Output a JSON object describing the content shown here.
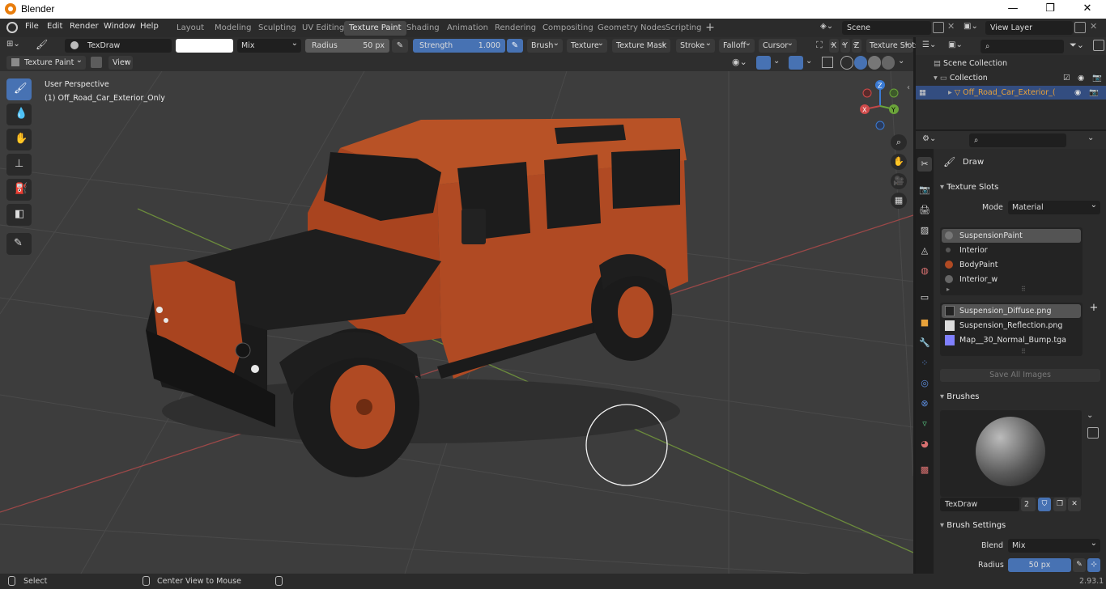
{
  "window": {
    "title": "Blender",
    "minimize": "—",
    "maximize": "❐",
    "close": "✕"
  },
  "menu": [
    "File",
    "Edit",
    "Render",
    "Window",
    "Help"
  ],
  "workspaces": [
    "Layout",
    "Modeling",
    "Sculpting",
    "UV Editing",
    "Texture Paint",
    "Shading",
    "Animation",
    "Rendering",
    "Compositing",
    "Geometry Nodes",
    "Scripting"
  ],
  "active_workspace": "Texture Paint",
  "scene": {
    "name": "Scene",
    "view_layer": "View Layer"
  },
  "tool_header": {
    "brush_name": "TexDraw",
    "blend": "Mix",
    "radius_label": "Radius",
    "radius_value": "50 px",
    "strength_label": "Strength",
    "strength_value": "1.000",
    "menus": [
      "Brush",
      "Texture",
      "Texture Mask",
      "Stroke",
      "Falloff",
      "Cursor"
    ],
    "axes": [
      "X",
      "Y",
      "Z"
    ],
    "texture_slots": "Texture Slots"
  },
  "header2": {
    "mode": "Texture Paint",
    "view": "View"
  },
  "viewport": {
    "perspective": "User Perspective",
    "object": "(1) Off_Road_Car_Exterior_Only",
    "gizmo": {
      "x": "X",
      "y": "Y",
      "z": "Z"
    }
  },
  "outliner": {
    "scene_collection": "Scene Collection",
    "collection": "Collection",
    "object": "Off_Road_Car_Exterior_("
  },
  "properties": {
    "tool_name": "Draw",
    "texture_slots_title": "Texture Slots",
    "mode_label": "Mode",
    "mode_value": "Material",
    "materials": [
      "SuspensionPaint",
      "Interior",
      "BodyPaint",
      "Interior_w"
    ],
    "images": [
      "Suspension_Diffuse.png",
      "Suspension_Reflection.png",
      "Map__30_Normal_Bump.tga"
    ],
    "save_all": "Save All Images",
    "brushes_title": "Brushes",
    "brush_name": "TexDraw",
    "brush_users": "2",
    "brush_settings_title": "Brush Settings",
    "blend_label": "Blend",
    "blend_value": "Mix",
    "radius_label": "Radius",
    "radius_value": "50 px"
  },
  "status": {
    "select": "Select",
    "center": "Center View to Mouse",
    "version": "2.93.1"
  },
  "colors": {
    "accent": "#4772b3",
    "car_body": "#b5451e",
    "active_tab": "#474747"
  }
}
